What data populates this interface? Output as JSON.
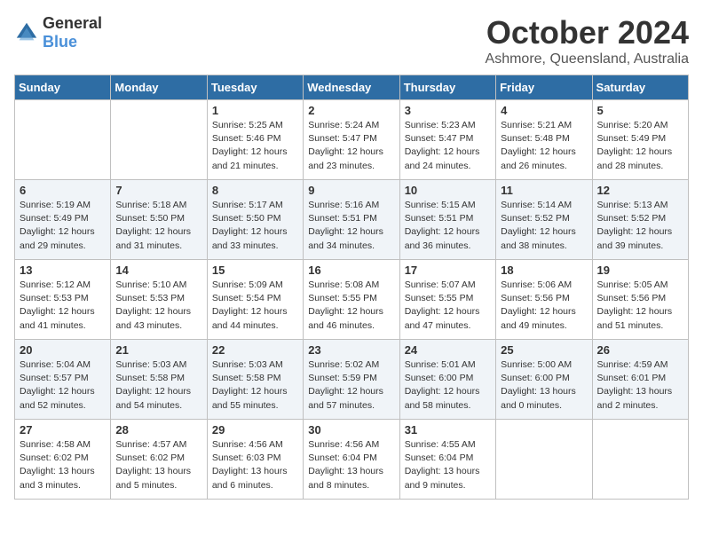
{
  "header": {
    "logo_general": "General",
    "logo_blue": "Blue",
    "month": "October 2024",
    "location": "Ashmore, Queensland, Australia"
  },
  "days_of_week": [
    "Sunday",
    "Monday",
    "Tuesday",
    "Wednesday",
    "Thursday",
    "Friday",
    "Saturday"
  ],
  "weeks": [
    [
      {
        "day": "",
        "info": ""
      },
      {
        "day": "",
        "info": ""
      },
      {
        "day": "1",
        "info": "Sunrise: 5:25 AM\nSunset: 5:46 PM\nDaylight: 12 hours\nand 21 minutes."
      },
      {
        "day": "2",
        "info": "Sunrise: 5:24 AM\nSunset: 5:47 PM\nDaylight: 12 hours\nand 23 minutes."
      },
      {
        "day": "3",
        "info": "Sunrise: 5:23 AM\nSunset: 5:47 PM\nDaylight: 12 hours\nand 24 minutes."
      },
      {
        "day": "4",
        "info": "Sunrise: 5:21 AM\nSunset: 5:48 PM\nDaylight: 12 hours\nand 26 minutes."
      },
      {
        "day": "5",
        "info": "Sunrise: 5:20 AM\nSunset: 5:49 PM\nDaylight: 12 hours\nand 28 minutes."
      }
    ],
    [
      {
        "day": "6",
        "info": "Sunrise: 5:19 AM\nSunset: 5:49 PM\nDaylight: 12 hours\nand 29 minutes."
      },
      {
        "day": "7",
        "info": "Sunrise: 5:18 AM\nSunset: 5:50 PM\nDaylight: 12 hours\nand 31 minutes."
      },
      {
        "day": "8",
        "info": "Sunrise: 5:17 AM\nSunset: 5:50 PM\nDaylight: 12 hours\nand 33 minutes."
      },
      {
        "day": "9",
        "info": "Sunrise: 5:16 AM\nSunset: 5:51 PM\nDaylight: 12 hours\nand 34 minutes."
      },
      {
        "day": "10",
        "info": "Sunrise: 5:15 AM\nSunset: 5:51 PM\nDaylight: 12 hours\nand 36 minutes."
      },
      {
        "day": "11",
        "info": "Sunrise: 5:14 AM\nSunset: 5:52 PM\nDaylight: 12 hours\nand 38 minutes."
      },
      {
        "day": "12",
        "info": "Sunrise: 5:13 AM\nSunset: 5:52 PM\nDaylight: 12 hours\nand 39 minutes."
      }
    ],
    [
      {
        "day": "13",
        "info": "Sunrise: 5:12 AM\nSunset: 5:53 PM\nDaylight: 12 hours\nand 41 minutes."
      },
      {
        "day": "14",
        "info": "Sunrise: 5:10 AM\nSunset: 5:53 PM\nDaylight: 12 hours\nand 43 minutes."
      },
      {
        "day": "15",
        "info": "Sunrise: 5:09 AM\nSunset: 5:54 PM\nDaylight: 12 hours\nand 44 minutes."
      },
      {
        "day": "16",
        "info": "Sunrise: 5:08 AM\nSunset: 5:55 PM\nDaylight: 12 hours\nand 46 minutes."
      },
      {
        "day": "17",
        "info": "Sunrise: 5:07 AM\nSunset: 5:55 PM\nDaylight: 12 hours\nand 47 minutes."
      },
      {
        "day": "18",
        "info": "Sunrise: 5:06 AM\nSunset: 5:56 PM\nDaylight: 12 hours\nand 49 minutes."
      },
      {
        "day": "19",
        "info": "Sunrise: 5:05 AM\nSunset: 5:56 PM\nDaylight: 12 hours\nand 51 minutes."
      }
    ],
    [
      {
        "day": "20",
        "info": "Sunrise: 5:04 AM\nSunset: 5:57 PM\nDaylight: 12 hours\nand 52 minutes."
      },
      {
        "day": "21",
        "info": "Sunrise: 5:03 AM\nSunset: 5:58 PM\nDaylight: 12 hours\nand 54 minutes."
      },
      {
        "day": "22",
        "info": "Sunrise: 5:03 AM\nSunset: 5:58 PM\nDaylight: 12 hours\nand 55 minutes."
      },
      {
        "day": "23",
        "info": "Sunrise: 5:02 AM\nSunset: 5:59 PM\nDaylight: 12 hours\nand 57 minutes."
      },
      {
        "day": "24",
        "info": "Sunrise: 5:01 AM\nSunset: 6:00 PM\nDaylight: 12 hours\nand 58 minutes."
      },
      {
        "day": "25",
        "info": "Sunrise: 5:00 AM\nSunset: 6:00 PM\nDaylight: 13 hours\nand 0 minutes."
      },
      {
        "day": "26",
        "info": "Sunrise: 4:59 AM\nSunset: 6:01 PM\nDaylight: 13 hours\nand 2 minutes."
      }
    ],
    [
      {
        "day": "27",
        "info": "Sunrise: 4:58 AM\nSunset: 6:02 PM\nDaylight: 13 hours\nand 3 minutes."
      },
      {
        "day": "28",
        "info": "Sunrise: 4:57 AM\nSunset: 6:02 PM\nDaylight: 13 hours\nand 5 minutes."
      },
      {
        "day": "29",
        "info": "Sunrise: 4:56 AM\nSunset: 6:03 PM\nDaylight: 13 hours\nand 6 minutes."
      },
      {
        "day": "30",
        "info": "Sunrise: 4:56 AM\nSunset: 6:04 PM\nDaylight: 13 hours\nand 8 minutes."
      },
      {
        "day": "31",
        "info": "Sunrise: 4:55 AM\nSunset: 6:04 PM\nDaylight: 13 hours\nand 9 minutes."
      },
      {
        "day": "",
        "info": ""
      },
      {
        "day": "",
        "info": ""
      }
    ]
  ]
}
